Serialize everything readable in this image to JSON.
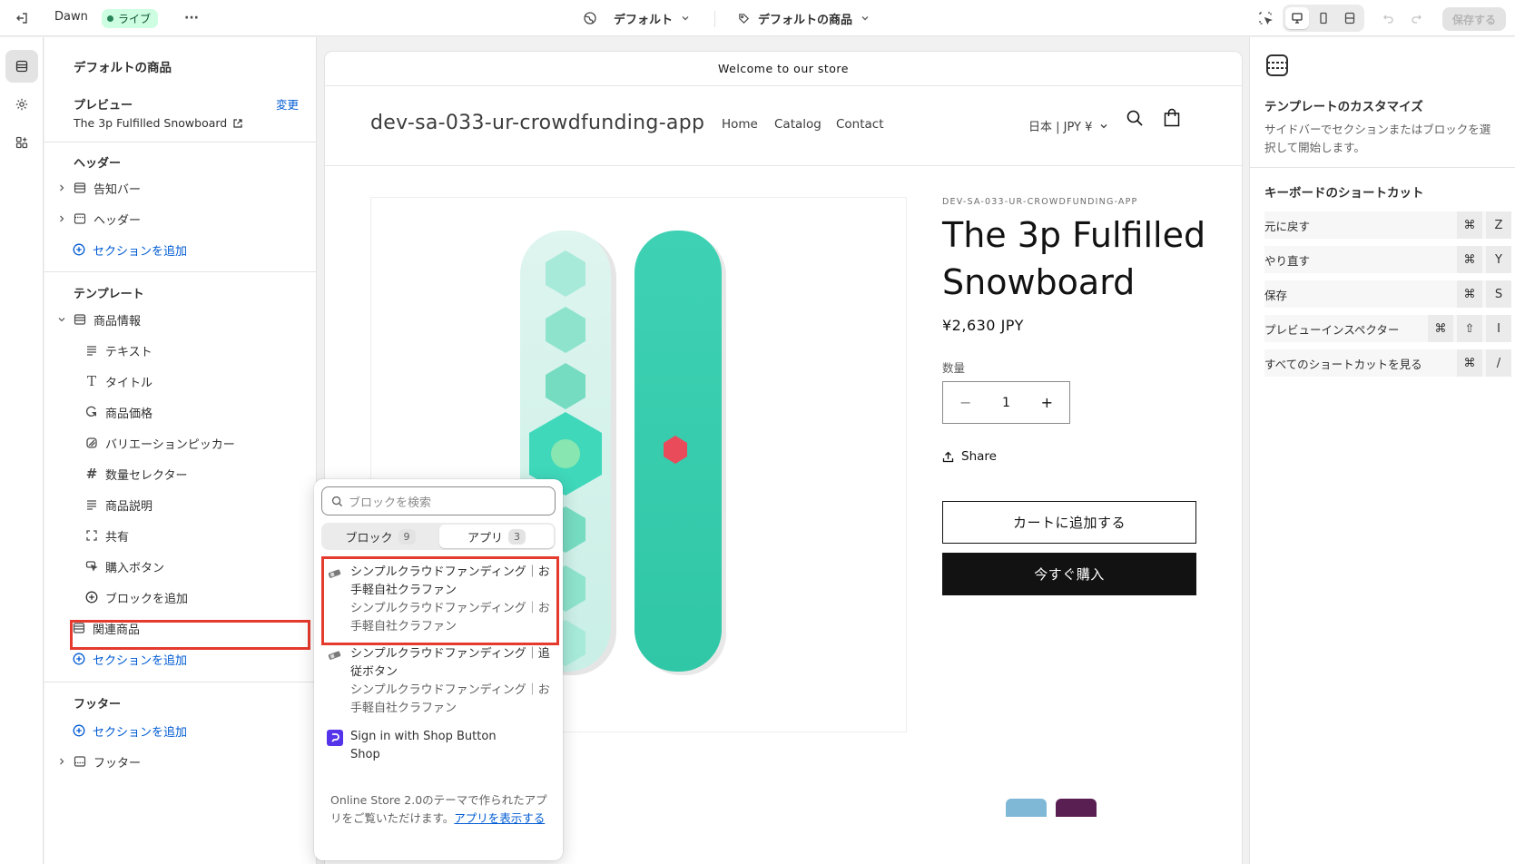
{
  "topbar": {
    "theme_name": "Dawn",
    "live_badge": "ライブ",
    "more": "···",
    "market_select": "デフォルト",
    "template_select": "デフォルトの商品",
    "save_label": "保存する"
  },
  "sidebar": {
    "title": "デフォルトの商品",
    "preview_label": "プレビュー",
    "change_link": "変更",
    "preview_product": "The 3p Fulfilled Snowboard",
    "header_section": "ヘッダー",
    "header_items": [
      "告知バー",
      "ヘッダー"
    ],
    "add_section": "セクションを追加",
    "template_section": "テンプレート",
    "product_info": "商品情報",
    "blocks": [
      "テキスト",
      "タイトル",
      "商品価格",
      "バリエーションピッカー",
      "数量セレクター",
      "商品説明",
      "共有",
      "購入ボタン"
    ],
    "add_block": "ブロックを追加",
    "related_products": "関連商品",
    "footer_section": "フッター",
    "footer_item": "フッター"
  },
  "store": {
    "announcement": "Welcome to our store",
    "name": "dev-sa-033-ur-crowdfunding-app",
    "nav": [
      "Home",
      "Catalog",
      "Contact"
    ],
    "locale": "日本 | JPY ¥",
    "vendor": "DEV-SA-033-UR-CROWDFUNDING-APP",
    "title": "The 3p Fulfilled Snowboard",
    "price": "¥2,630 JPY",
    "qty_label": "数量",
    "qty_value": "1",
    "share": "Share",
    "add_to_cart": "カートに追加する",
    "buy_now": "今すぐ購入"
  },
  "picker": {
    "search_placeholder": "ブロックを検索",
    "tab_blocks": "ブロック",
    "tab_blocks_count": "9",
    "tab_apps": "アプリ",
    "tab_apps_count": "3",
    "items": [
      {
        "title": "シンプルクラウドファンディング｜お手軽自社クラファン",
        "sub": "シンプルクラウドファンディング｜お手軽自社クラファン"
      },
      {
        "title": "シンプルクラウドファンディング｜追従ボタン",
        "sub": "シンプルクラウドファンディング｜お手軽自社クラファン"
      },
      {
        "title": "Sign in with Shop Button",
        "sub": "Shop"
      }
    ],
    "footer_text": "Online Store 2.0のテーマで作られたアプリをご覧いただけます。",
    "footer_link": "アプリを表示する"
  },
  "rpanel": {
    "heading": "テンプレートのカスタマイズ",
    "description": "サイドバーでセクションまたはブロックを選択して開始します。",
    "shortcuts_heading": "キーボードのショートカット",
    "shortcuts": [
      {
        "label": "元に戻す",
        "keys": [
          "⌘",
          "Z"
        ]
      },
      {
        "label": "やり直す",
        "keys": [
          "⌘",
          "Y"
        ]
      },
      {
        "label": "保存",
        "keys": [
          "⌘",
          "S"
        ]
      },
      {
        "label": "プレビューインスペクター",
        "keys": [
          "⌘",
          "⇧",
          "I"
        ]
      },
      {
        "label": "すべてのショートカットを見る",
        "keys": [
          "⌘",
          "/"
        ]
      }
    ]
  },
  "colors": {
    "accent_link": "#005bd3",
    "live_badge_bg": "#cdfee1",
    "highlight": "#e53a2e",
    "snowboard_teal": "#3fd1b4",
    "buy_button": "#121212"
  }
}
